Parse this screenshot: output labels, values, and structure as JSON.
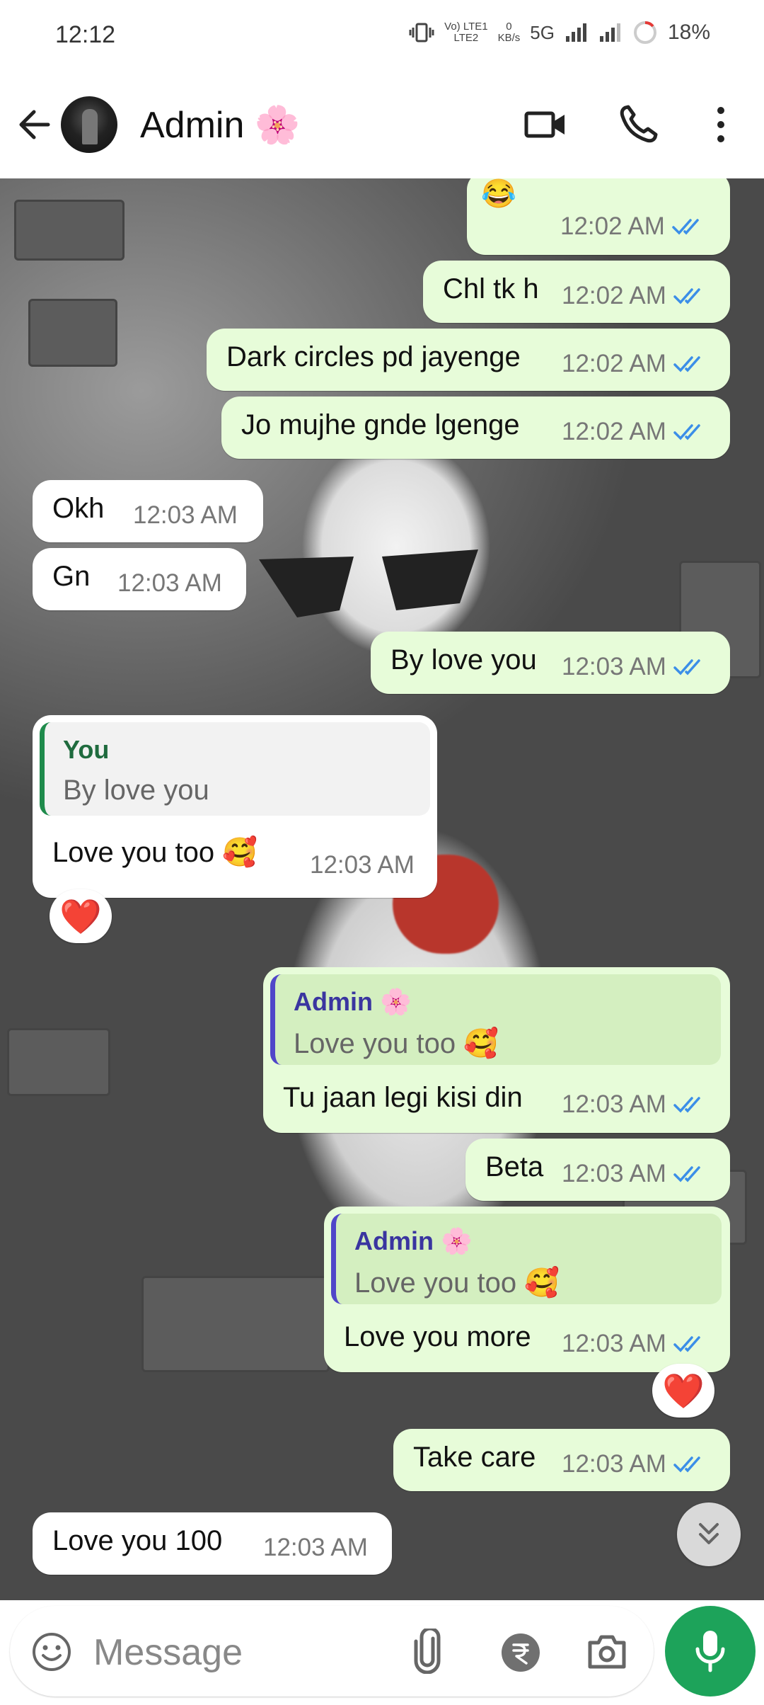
{
  "status": {
    "time": "12:12",
    "net1": "Vo) LTE1",
    "net2": "LTE2",
    "speed_top": "0",
    "speed_unit": "KB/s",
    "gen": "5G",
    "battery": "18%"
  },
  "header": {
    "contact_name": "Admin 🌸"
  },
  "messages": [
    {
      "dir": "out",
      "text": "😂",
      "time": "12:02 AM"
    },
    {
      "dir": "out",
      "text": "Chl tk h",
      "time": "12:02 AM"
    },
    {
      "dir": "out",
      "text": "Dark circles pd jayenge",
      "time": "12:02 AM"
    },
    {
      "dir": "out",
      "text": "Jo mujhe gnde lgenge",
      "time": "12:02 AM"
    },
    {
      "dir": "in",
      "text": "Okh",
      "time": "12:03 AM"
    },
    {
      "dir": "in",
      "text": "Gn",
      "time": "12:03 AM"
    },
    {
      "dir": "out",
      "text": "By love you",
      "time": "12:03 AM"
    },
    {
      "dir": "in",
      "quote_name": "You",
      "quote_text": "By love you",
      "text": "Love you too 🥰",
      "time": "12:03 AM",
      "reaction": "❤️"
    },
    {
      "dir": "out",
      "quote_name": "Admin 🌸",
      "quote_text": "Love you too 🥰",
      "text": "Tu jaan legi kisi din",
      "time": "12:03 AM"
    },
    {
      "dir": "out",
      "text": "Beta",
      "time": "12:03 AM"
    },
    {
      "dir": "out",
      "quote_name": "Admin 🌸",
      "quote_text": "Love you too 🥰",
      "text": "Love you more",
      "time": "12:03 AM",
      "reaction": "❤️"
    },
    {
      "dir": "out",
      "text": "Take care",
      "time": "12:03 AM"
    },
    {
      "dir": "in",
      "text": "Love you 100",
      "time": "12:03 AM"
    }
  ],
  "composer": {
    "placeholder": "Message"
  },
  "colors": {
    "accent_green": "#1da35a",
    "read_tick": "#3b8ee8",
    "out_bubble": "#e7fcd9",
    "in_bubble": "#ffffff"
  }
}
